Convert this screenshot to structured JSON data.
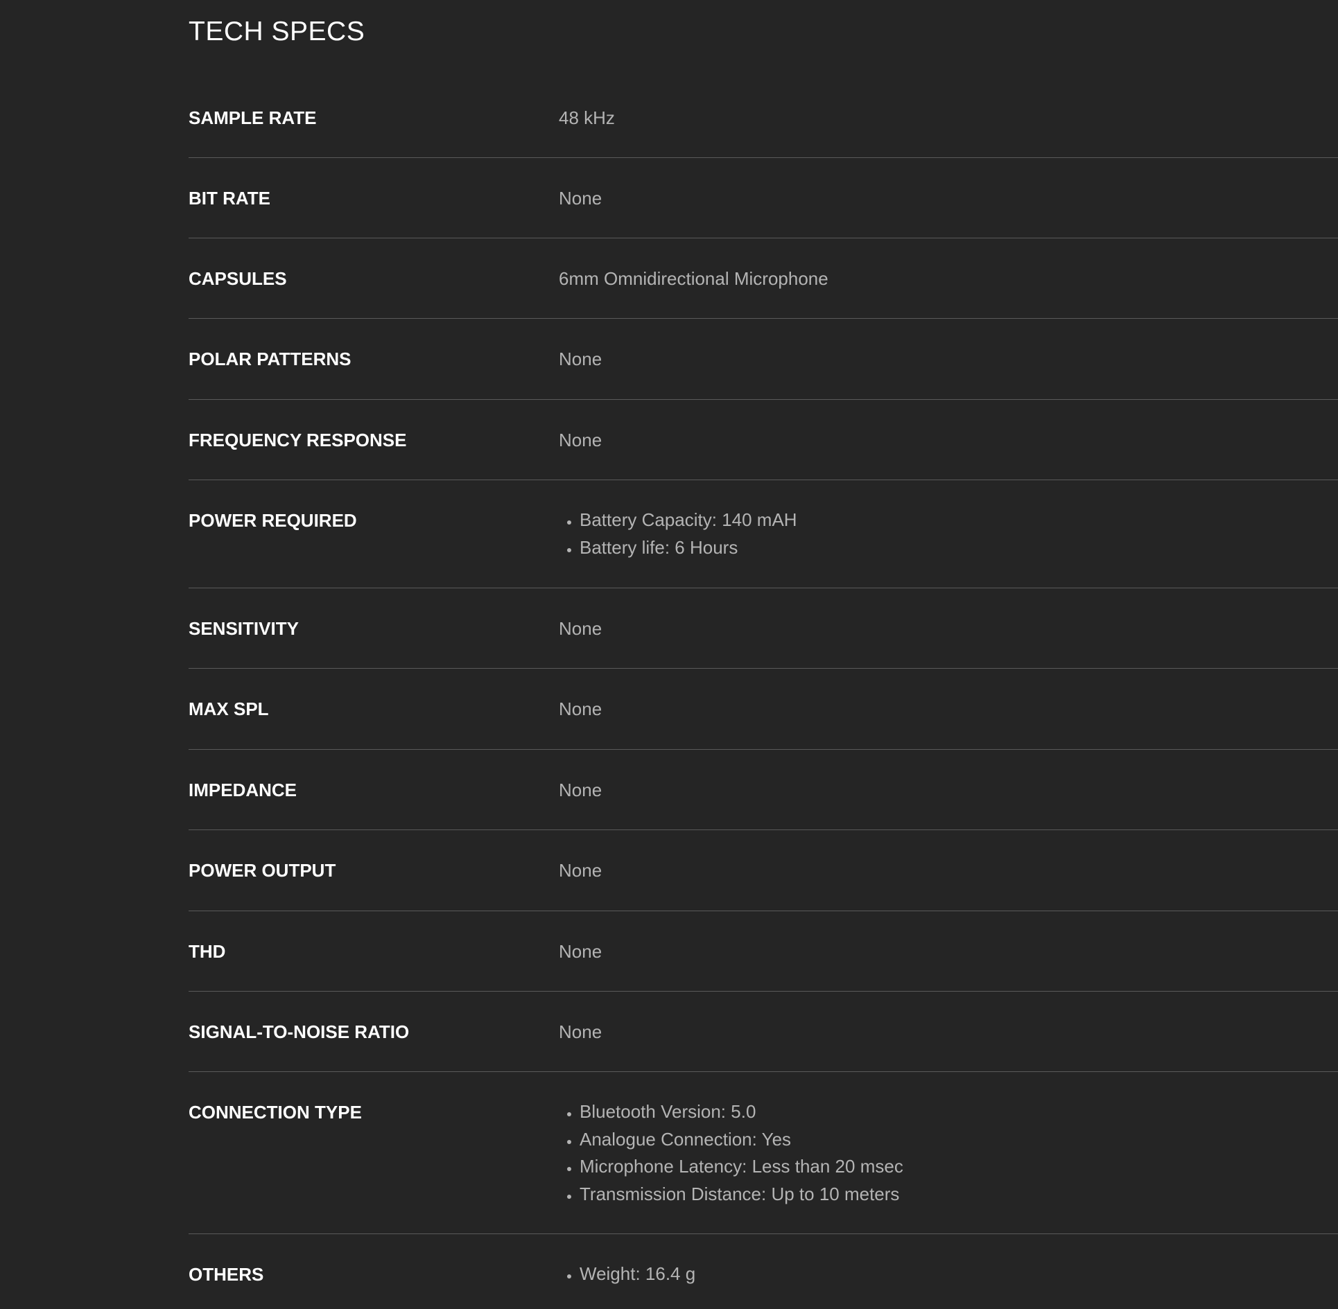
{
  "page": {
    "title": "TECH SPECS"
  },
  "specs": [
    {
      "label": "SAMPLE RATE",
      "value": "48 kHz"
    },
    {
      "label": "BIT RATE",
      "value": "None"
    },
    {
      "label": "CAPSULES",
      "value": "6mm Omnidirectional Microphone"
    },
    {
      "label": "POLAR PATTERNS",
      "value": "None"
    },
    {
      "label": "FREQUENCY RESPONSE",
      "value": "None"
    },
    {
      "label": "POWER REQUIRED",
      "list": [
        "Battery Capacity: 140 mAH",
        "Battery life: 6 Hours"
      ]
    },
    {
      "label": "SENSITIVITY",
      "value": "None"
    },
    {
      "label": "MAX SPL",
      "value": "None"
    },
    {
      "label": "IMPEDANCE",
      "value": "None"
    },
    {
      "label": "POWER OUTPUT",
      "value": "None"
    },
    {
      "label": "THD",
      "value": "None"
    },
    {
      "label": "SIGNAL-TO-NOISE RATIO",
      "value": "None"
    },
    {
      "label": "CONNECTION TYPE",
      "list": [
        "Bluetooth Version: 5.0",
        "Analogue Connection: Yes",
        "Microphone Latency: Less than 20 msec",
        "Transmission Distance: Up to 10 meters"
      ]
    },
    {
      "label": "OTHERS",
      "list": [
        "Weight: 16.4 g"
      ]
    }
  ],
  "colors": {
    "background": "#252525",
    "label": "#ffffff",
    "value": "#b4b4b4",
    "divider": "#5a5a5a"
  }
}
